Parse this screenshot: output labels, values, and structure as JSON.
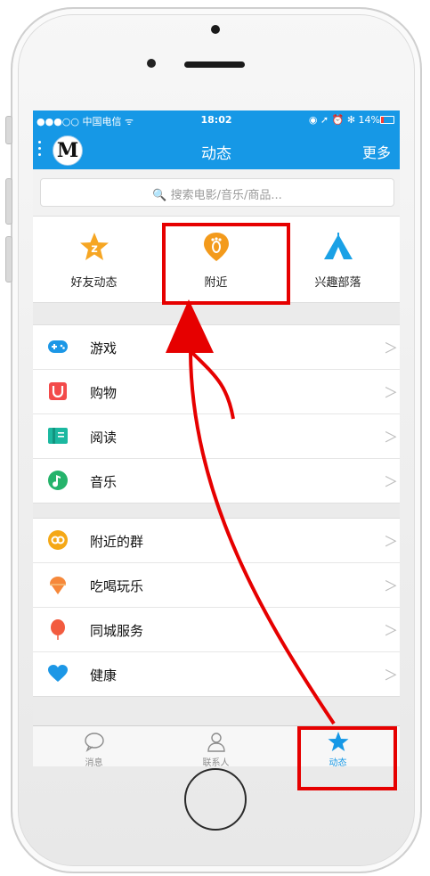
{
  "statusbar": {
    "carrier": "●●●○○ 中国电信 ᯤ",
    "time": "18:02",
    "battery_text": "◉ ➚ ⏰ ✻ 14%"
  },
  "navbar": {
    "avatar_glyph": "M",
    "title": "动态",
    "more_label": "更多"
  },
  "search": {
    "placeholder": "🔍 搜索电影/音乐/商品..."
  },
  "quick": [
    {
      "label": "好友动态",
      "icon": "friends-star-icon",
      "color": "#f6a623"
    },
    {
      "label": "附近",
      "icon": "nearby-footprint-icon",
      "color": "#f39a1b"
    },
    {
      "label": "兴趣部落",
      "icon": "tribe-tent-icon",
      "color": "#1aa1e6"
    }
  ],
  "group1": [
    {
      "label": "游戏",
      "icon": "gamepad-icon",
      "color": "#1c97e6"
    },
    {
      "label": "购物",
      "icon": "magnet-bag-icon",
      "color": "#f34a4a"
    },
    {
      "label": "阅读",
      "icon": "book-icon",
      "color": "#1bb8a0"
    },
    {
      "label": "音乐",
      "icon": "music-note-icon",
      "color": "#25b36b"
    }
  ],
  "group2": [
    {
      "label": "附近的群",
      "icon": "nearby-group-icon",
      "color": "#f5a816"
    },
    {
      "label": "吃喝玩乐",
      "icon": "ice-cream-icon",
      "color": "#f6883a"
    },
    {
      "label": "同城服务",
      "icon": "balloon-icon",
      "color": "#f25b3f"
    },
    {
      "label": "健康",
      "icon": "heart-icon",
      "color": "#1c97e6"
    }
  ],
  "chevron": "＞",
  "tabbar": [
    {
      "label": "消息",
      "icon": "message-bubble-icon"
    },
    {
      "label": "联系人",
      "icon": "contact-person-icon"
    },
    {
      "label": "动态",
      "icon": "star-icon"
    }
  ],
  "colors": {
    "accent": "#1698e6",
    "annotation": "#e60000"
  }
}
